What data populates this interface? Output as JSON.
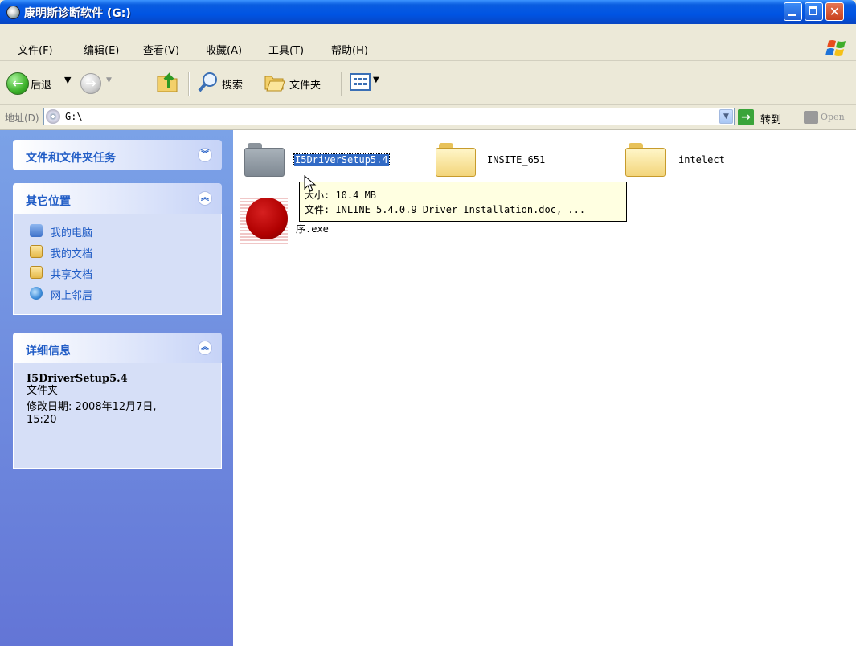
{
  "window": {
    "title": "康明斯诊断软件 (G:)"
  },
  "menu": {
    "items": [
      "文件(F)",
      "编辑(E)",
      "查看(V)",
      "收藏(A)",
      "工具(T)",
      "帮助(H)"
    ]
  },
  "toolbar": {
    "back_label": "后退",
    "search_label": "搜索",
    "folders_label": "文件夹"
  },
  "address": {
    "label": "地址(D)",
    "value": "G:\\",
    "goto_label": "转到",
    "open_label": "Open"
  },
  "taskpane": {
    "tasks_title": "文件和文件夹任务",
    "places_title": "其它位置",
    "places": [
      "我的电脑",
      "我的文档",
      "共享文档",
      "网上邻居"
    ],
    "details_title": "详细信息",
    "details_name": "I5DriverSetup5.4",
    "details_type": "文件夹",
    "details_modified_line1": "修改日期: 2008年12月7日,",
    "details_modified_line2": "15:20"
  },
  "files": {
    "folder1": "I5DriverSetup5.4",
    "folder2": "INSITE_651",
    "folder3": "intelect",
    "exe_suffix": "序.exe"
  },
  "tooltip": {
    "line1": "大小: 10.4 MB",
    "line2": "文件: INLINE 5.4.0.9 Driver Installation.doc, ..."
  }
}
